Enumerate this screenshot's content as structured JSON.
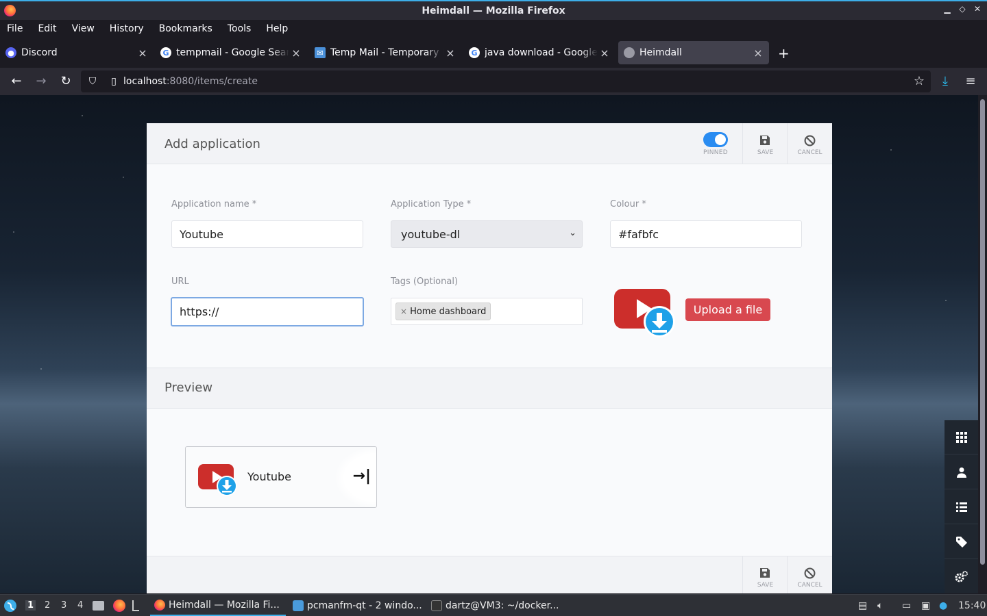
{
  "window": {
    "title": "Heimdall — Mozilla Firefox",
    "controls": {
      "minimize": "▁",
      "maximize": "◇",
      "close": "✕"
    }
  },
  "menubar": {
    "items": [
      "File",
      "Edit",
      "View",
      "History",
      "Bookmarks",
      "Tools",
      "Help"
    ]
  },
  "tabs": [
    {
      "label": "Discord",
      "icon": "discord-icon",
      "active": false
    },
    {
      "label": "tempmail - Google Search",
      "icon": "google-icon",
      "active": false
    },
    {
      "label": "Temp Mail - Temporary Email",
      "icon": "mail-icon",
      "active": false
    },
    {
      "label": "java download - Google Search",
      "icon": "google-icon",
      "active": false
    },
    {
      "label": "Heimdall",
      "icon": "heimdall-icon",
      "active": true
    }
  ],
  "navbar": {
    "url_host": "localhost",
    "url_path": ":8080/items/create"
  },
  "form": {
    "title": "Add application",
    "pinned_label": "PINNED",
    "pinned": true,
    "save_label": "SAVE",
    "cancel_label": "CANCEL",
    "app_name_label": "Application name *",
    "app_name_value": "Youtube",
    "app_type_label": "Application Type *",
    "app_type_value": "youtube-dl",
    "colour_label": "Colour *",
    "colour_value": "#fafbfc",
    "url_label": "URL",
    "url_value": "https://",
    "tags_label": "Tags (Optional)",
    "tag_value": "Home dashboard",
    "upload_label": "Upload a file"
  },
  "preview": {
    "title": "Preview",
    "tile_name": "Youtube"
  },
  "sidebar": {
    "items": [
      "grid-icon",
      "user-icon",
      "list-icon",
      "tag-icon",
      "settings-icon"
    ]
  },
  "taskbar": {
    "workspaces": [
      "1",
      "2",
      "3",
      "4"
    ],
    "tasks": [
      "Heimdall — Mozilla Fi...",
      "pcmanfm-qt - 2 windo...",
      "dartz@VM3: ~/docker..."
    ],
    "clock": "15:40"
  },
  "colors": {
    "accent": "#2a8cf1",
    "upload": "#d8484f",
    "youtube_red": "#cc2e2b",
    "download_blue": "#1ea1e8"
  }
}
